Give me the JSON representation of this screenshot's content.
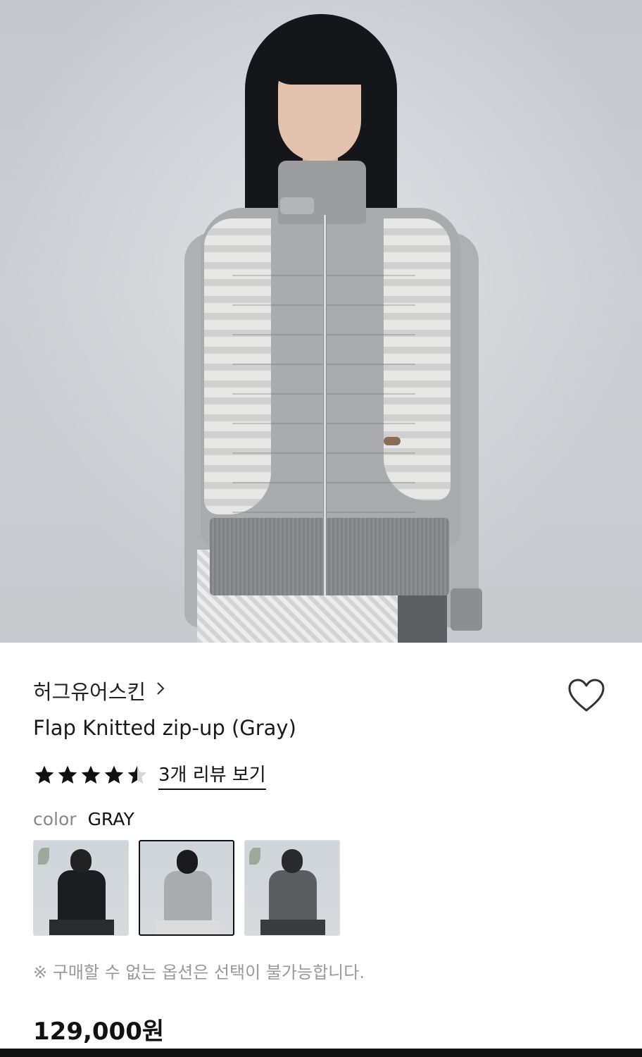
{
  "product": {
    "brand": "허그유어스킨",
    "title": "Flap Knitted zip-up (Gray)",
    "rating": 4.5,
    "review_link": "3개 리뷰 보기",
    "price": "129,000원"
  },
  "options": {
    "color_label": "color",
    "color_value": "GRAY",
    "variants": [
      {
        "name": "black",
        "selected": false
      },
      {
        "name": "gray",
        "selected": true
      },
      {
        "name": "charcoal",
        "selected": false
      }
    ],
    "notice": "※ 구매할 수 없는 옵션은 선택이 불가능합니다."
  },
  "icons": {
    "wishlist": "heart-outline-icon",
    "brand_link": "chevron-right-icon",
    "star": "star-icon"
  },
  "colors": {
    "text": "#111111",
    "muted": "#888888",
    "notice": "#999999",
    "star": "#111111"
  }
}
